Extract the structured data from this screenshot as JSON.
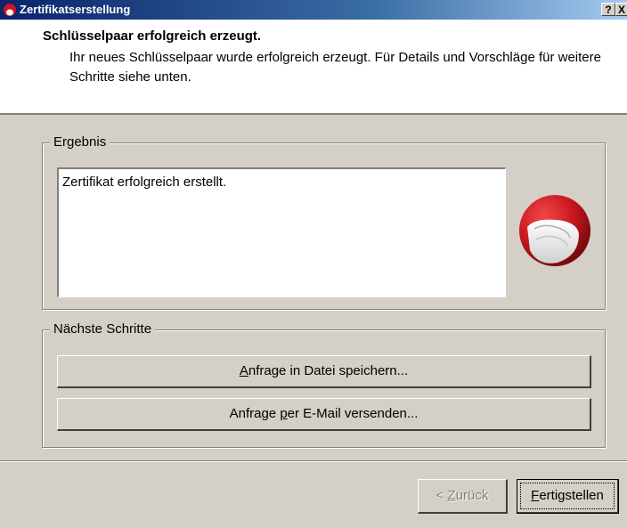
{
  "window": {
    "title": "Zertifikatserstellung",
    "help_label": "?",
    "close_label": "X"
  },
  "header": {
    "title": "Schlüsselpaar erfolgreich erzeugt.",
    "description": "Ihr neues Schlüsselpaar wurde erfolgreich erzeugt. Für Details und Vorschläge für weitere Schritte siehe unten."
  },
  "result_group": {
    "label": "Ergebnis",
    "text": "Zertifikat erfolgreich erstellt.",
    "icon": "certificate-icon"
  },
  "next_steps_group": {
    "label": "Nächste Schritte",
    "save_button": {
      "mnemonic": "A",
      "rest": "nfrage in Datei speichern..."
    },
    "mail_button": {
      "before": "Anfrage ",
      "mnemonic": "p",
      "after": "er E-Mail versenden..."
    }
  },
  "footer": {
    "back_button": {
      "prefix": "< ",
      "mnemonic": "Z",
      "rest": "urück",
      "enabled": false
    },
    "finish_button": {
      "mnemonic": "F",
      "rest": "ertigstellen"
    }
  },
  "colors": {
    "titlebar_start": "#0a246a",
    "titlebar_end": "#a6caf0",
    "dialog_bg": "#d4d0c8",
    "icon_red": "#c8171e"
  }
}
